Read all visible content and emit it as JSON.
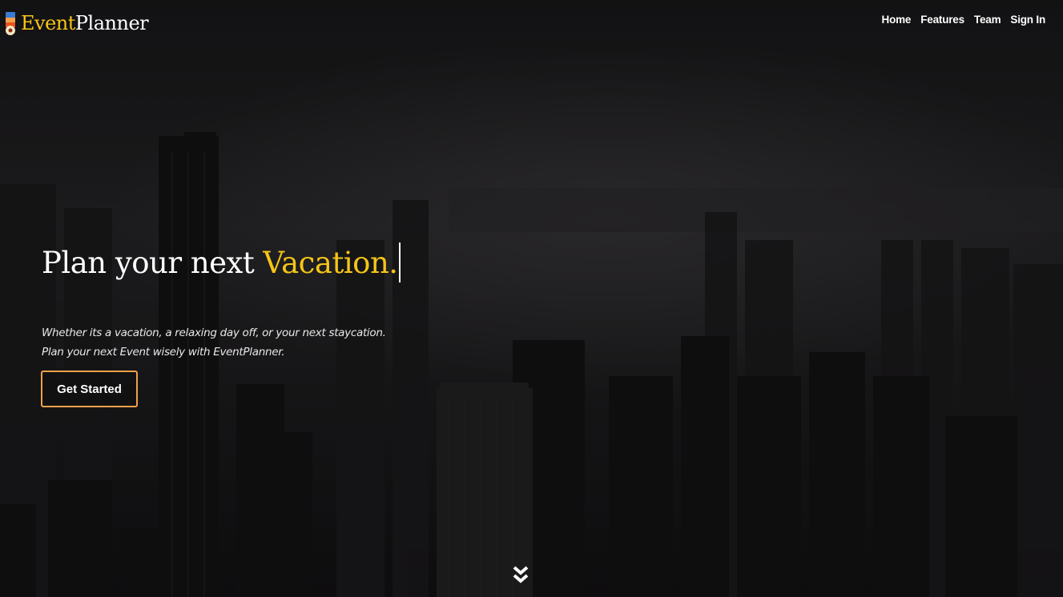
{
  "brand": {
    "accent": "Event",
    "rest": "Planner",
    "logo_icon": "brand-logo-icon"
  },
  "nav": {
    "items": [
      {
        "label": "Home"
      },
      {
        "label": "Features"
      },
      {
        "label": "Team"
      },
      {
        "label": "Sign In"
      }
    ]
  },
  "hero": {
    "title_prefix": "Plan your next",
    "title_highlight": "Vacation.",
    "subtitle_line1": "Whether its a vacation, a relaxing day off, or your next staycation.",
    "subtitle_line2": "Plan your next Event wisely with EventPlanner.",
    "cta_label": "Get Started",
    "scroll_icon": "chevron-double-down-icon"
  },
  "colors": {
    "accent": "#f5c518",
    "button_border": "#f0a14a",
    "background": "#151416"
  }
}
